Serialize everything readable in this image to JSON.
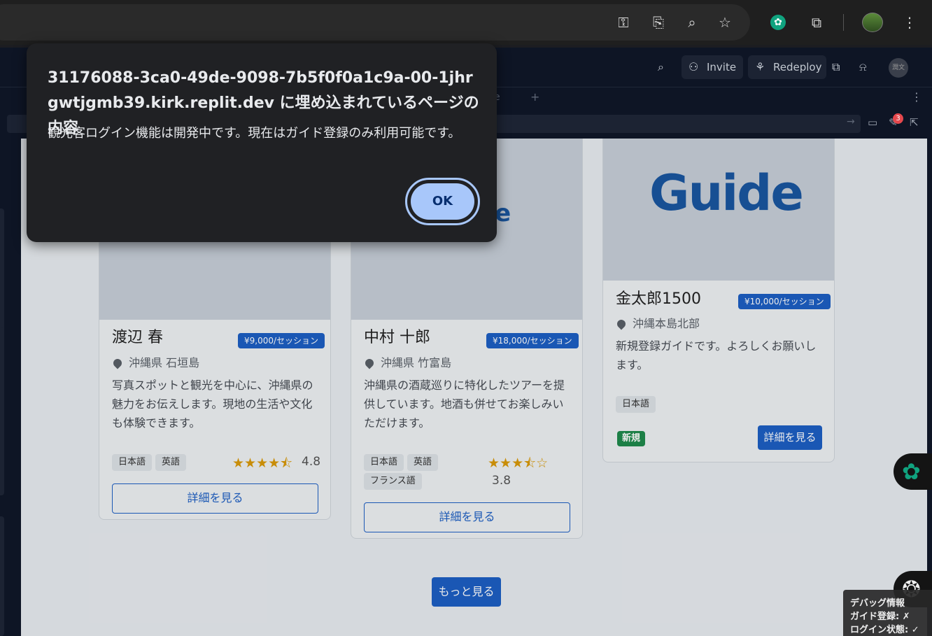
{
  "chrome": {
    "icons": [
      "key-icon",
      "install-icon",
      "zoom-icon",
      "bookmark-star-icon",
      "chatgpt-extension-icon",
      "extensions-puzzle-icon",
      "profile-avatar",
      "menu-dots-icon"
    ]
  },
  "replit": {
    "invite_label": "Invite",
    "redeploy_label": "Redeploy",
    "tab_partial": "e",
    "notification_count": "3",
    "user_initials": "潤文"
  },
  "dialog": {
    "title": "31176088-3ca0-49de-9098-7b5f0f0a1c9a-00-1jhrgwtjgmb39.kirk.replit.dev に埋め込まれているページの内容",
    "message": "観光客ログイン機能は開発中です。現在はガイド登録のみ利用可能です。",
    "ok_label": "OK"
  },
  "cards": [
    {
      "name": "渡辺 春",
      "price": "¥9,000/セッション",
      "location": "沖縄県 石垣島",
      "description": "写真スポットと観光を中心に、沖縄県の魅力をお伝えします。現地の生活や文化も体験できます。",
      "languages": [
        "日本語",
        "英語"
      ],
      "stars": "★★★★⯪",
      "rating": "4.8",
      "button": "詳細を見る"
    },
    {
      "image_text": "Guide",
      "name": "中村 十郎",
      "price": "¥18,000/セッション",
      "location": "沖縄県 竹富島",
      "description": "沖縄県の酒蔵巡りに特化したツアーを提供しています。地酒も併せてお楽しみいただけます。",
      "languages": [
        "日本語",
        "英語",
        "フランス語"
      ],
      "stars": "★★★⯪☆",
      "rating": "3.8",
      "button": "詳細を見る"
    },
    {
      "image_text": "Guide",
      "name": "金太郎1500",
      "price": "¥10,000/セッション",
      "location": "沖縄本島北部",
      "description": "新規登録ガイドです。よろしくお願いします。",
      "languages": [
        "日本語"
      ],
      "badge": "新規",
      "button": "詳細を見る"
    }
  ],
  "more_button": "もっと見る",
  "debug": {
    "title": "デバッグ情報",
    "line1": "ガイド登録: ✗",
    "line2": "ログイン状態: ✓"
  },
  "colors": {
    "primary": "#1d5fc4",
    "dialog_bg": "#202124",
    "ok_button": "#a8c7fa",
    "star": "#d99a0a",
    "new_badge": "#1f8a4c"
  }
}
